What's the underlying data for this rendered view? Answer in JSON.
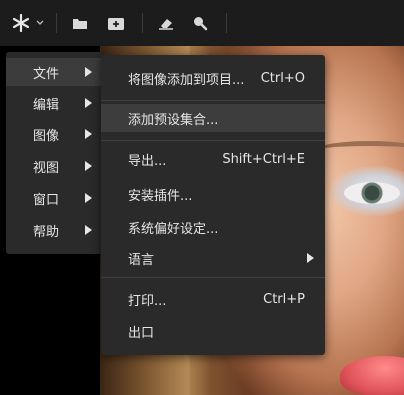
{
  "toolbar": {
    "icons": [
      "star-burst-icon",
      "chevron-down-icon",
      "folder-icon",
      "add-image-icon",
      "eraser-icon",
      "zoom-icon"
    ]
  },
  "main_menu": {
    "items": [
      {
        "label": "文件",
        "active": true
      },
      {
        "label": "编辑"
      },
      {
        "label": "图像"
      },
      {
        "label": "视图"
      },
      {
        "label": "窗口"
      },
      {
        "label": "帮助"
      }
    ]
  },
  "file_menu": {
    "items": [
      {
        "label": "将图像添加到项目...",
        "shortcut": "Ctrl+O"
      },
      {
        "label": "添加预设集合...",
        "active": true
      },
      {
        "label": "导出...",
        "shortcut": "Shift+Ctrl+E"
      },
      {
        "label": "安装插件..."
      },
      {
        "label": "系统偏好设定..."
      },
      {
        "label": "语言",
        "submenu": true
      },
      {
        "label": "打印...",
        "shortcut": "Ctrl+P"
      },
      {
        "label": "出口"
      }
    ]
  }
}
